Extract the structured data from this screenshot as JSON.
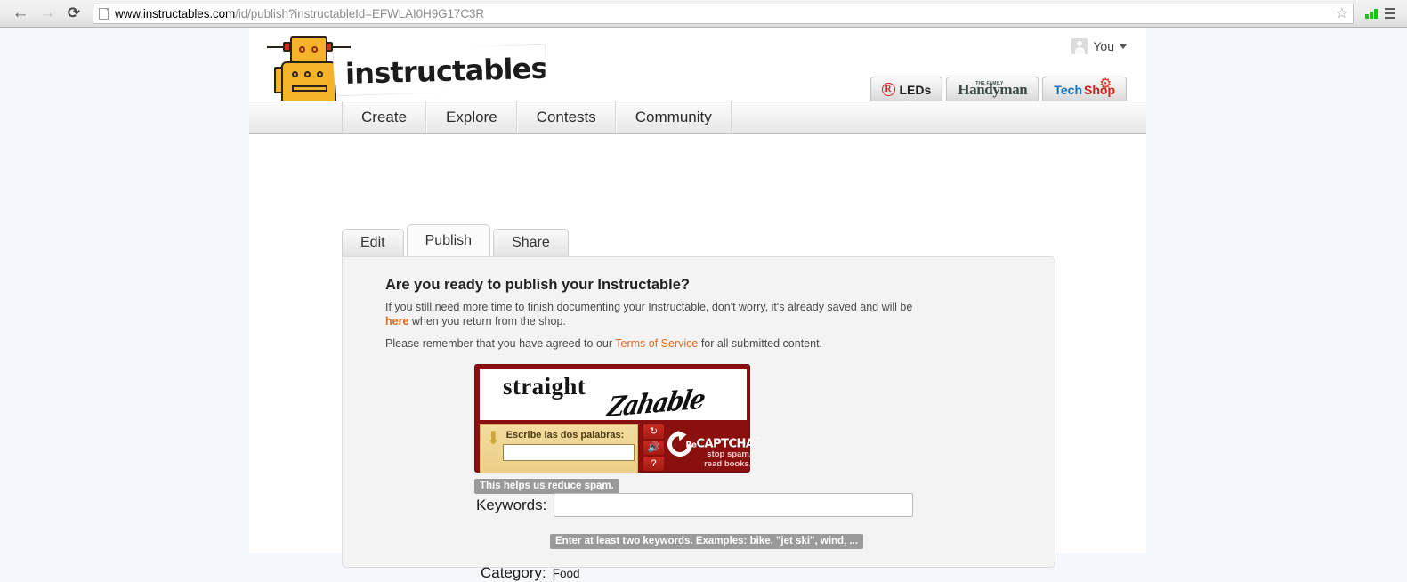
{
  "browser": {
    "back_icon": "back-arrow-icon",
    "forward_icon": "forward-arrow-icon",
    "reload_icon": "reload-icon",
    "page_icon": "page-document-icon",
    "url_domain": "www.instructables.com",
    "url_path": "/id/publish?instructableId=EFWLAI0H9G17C3R",
    "star_glyph": "☆",
    "extension_icon": "signal-bars-icon",
    "menu_icon": "hamburger-menu-icon"
  },
  "header": {
    "logo_text": "instructables",
    "robot_icon": "instructables-robot-icon",
    "user": {
      "name": "You",
      "avatar_icon": "user-avatar-placeholder-icon",
      "caret_icon": "chevron-down-icon"
    },
    "sponsors": [
      {
        "label": "LEDs",
        "mark": "R"
      },
      {
        "small": "THE FAMILY",
        "main": "Handyman"
      },
      {
        "tech": "Tech",
        "shop": "Shop",
        "gear_icon": "gear-icon"
      }
    ]
  },
  "nav": {
    "items": [
      {
        "label": "Create"
      },
      {
        "label": "Explore"
      },
      {
        "label": "Contests"
      },
      {
        "label": "Community"
      }
    ]
  },
  "tabs": [
    {
      "label": "Edit",
      "active": false
    },
    {
      "label": "Publish",
      "active": true
    },
    {
      "label": "Share",
      "active": false
    }
  ],
  "publish": {
    "heading": "Are you ready to publish your Instructable?",
    "para1_before": "If you still need more time to finish documenting your Instructable, don't worry, it's already saved and will be ",
    "para1_link": "here",
    "para1_after": " when you return from the shop.",
    "para2_before": "Please remember that you have agreed to our ",
    "para2_link": "Terms of Service",
    "para2_after": " for all submitted content.",
    "recaptcha": {
      "word1": "straight",
      "word2": "Zahable",
      "prompt": "Escribe las dos palabras:",
      "input_value": "",
      "refresh_glyph": "↻",
      "audio_glyph": "🔊",
      "help_glyph": "?",
      "brand_re": "Re",
      "brand_name": "CAPTCHA",
      "brand_tm": "™",
      "tagline": "stop spam. read books.",
      "arrow_glyph": "⬇"
    },
    "spam_tooltip": "This helps us reduce spam.",
    "keywords_label": "Keywords:",
    "keywords_value": "",
    "keywords_tooltip": "Enter at least two keywords. Examples: bike, \"jet ski\", wind, ...",
    "category_label": "Category:",
    "category_value": "Food"
  },
  "colors": {
    "accent_orange": "#e06c1e",
    "recaptcha_red": "#8a0f0f",
    "page_bg": "#f4f8fc",
    "robot_yellow": "#f5b32b"
  }
}
